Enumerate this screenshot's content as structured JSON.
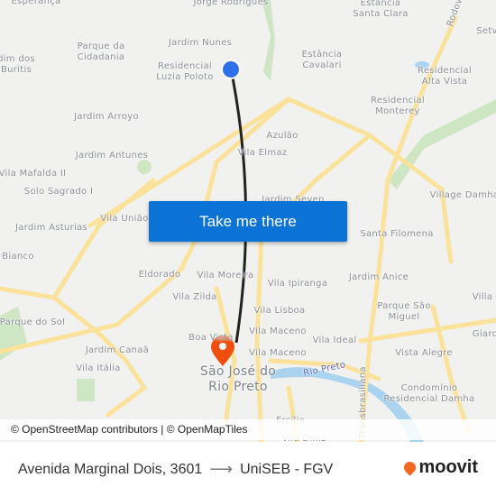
{
  "map": {
    "labels": {
      "esperanca": "Esperança",
      "jorge": "Jorge Rodrigues",
      "santa_clara": "Estância\nSanta Clara",
      "rodov": "Rodov",
      "setv": "Setv",
      "nunes": "Jardim Nunes",
      "cidadania": "Parque da\nCidadania",
      "buritis": "dim dos\nBuritis",
      "luzia": "Residencial\nLuzia Poloto",
      "cavalari": "Estância\nCavalari",
      "alta_vista": "Residencial\nAlta Vista",
      "monterey": "Residencial\nMonterey",
      "arroyo": "Jardim Arroyo",
      "azulao": "Azulão",
      "elmaz": "Vila Elmaz",
      "antunes": "Jardim Antunes",
      "mafalda": "Vila Mafalda II",
      "solo": "Solo Sagrado I",
      "village": "Village Damha",
      "seven": "Jardim Seven",
      "asturias": "Jardim Asturias",
      "uniao": "Vila União",
      "filomena": "Santa Filomena",
      "bianco": "Bianco",
      "eldorado": "Eldorado",
      "morei": "Vila Moreira",
      "anice": "Jardim Anice",
      "zilda": "Vila Zilda",
      "ipiranga": "Vila Ipiranga",
      "villa": "Villa",
      "sao_miguel": "Parque São\nMiguel",
      "lisboa": "Vila Lisboa",
      "parque_sol": "Parque do Sol",
      "maceno1": "Vila Maceno",
      "ideal": "Vila Ideal",
      "giard": "Giard",
      "boa_vista": "Boa Vista",
      "canaa": "Jardim Canaã",
      "maceno2": "Vila Maceno",
      "alegre": "Vista Alegre",
      "italia": "Vila Itália",
      "city": "São José do\nRio Preto",
      "rio": "Rio Preto",
      "damha": "Condomínio\nResidencial Damha",
      "ercilia": "Ercília",
      "diniz": "Vila Diniz",
      "transbrasiliana": "Transbrasiliana"
    },
    "origin_color": "#2f6fe8",
    "destination_color": "#f04e0f",
    "route_color": "#222222",
    "road_color": "#fbe29b"
  },
  "cta": {
    "label": "Take me there",
    "color": "#0b73d5"
  },
  "attribution": "© OpenStreetMap contributors | © OpenMapTiles",
  "footer": {
    "origin": "Avenida Marginal Dois, 3601",
    "arrow": "⟶",
    "destination": "UniSEB - FGV",
    "brand": "moovit",
    "brand_color": "#f26722"
  }
}
